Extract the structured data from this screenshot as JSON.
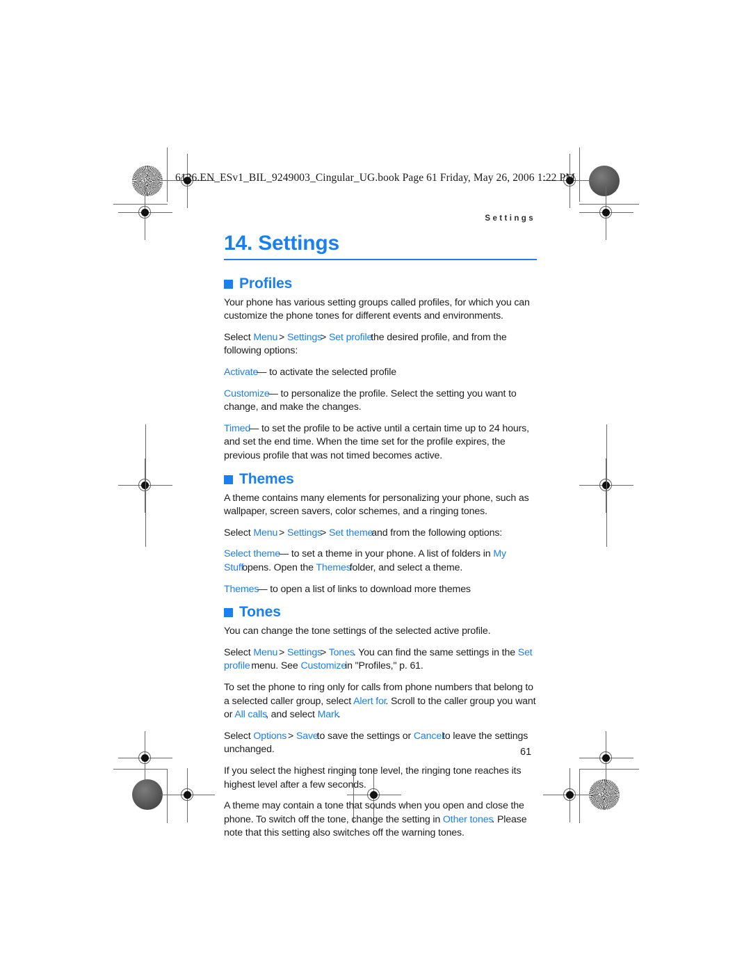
{
  "print_marks": {
    "file_header": "6126.EN_ESv1_BIL_9249003_Cingular_UG.book  Page 61  Friday, May 26, 2006  1:22 PM",
    "page_number": "61"
  },
  "running_header": "Settings",
  "colors": {
    "accent_blue": "#1a7ff0",
    "body_text": "#1d1d1d"
  },
  "chapter": {
    "title": "14. Settings"
  },
  "sections": [
    {
      "title": "Profiles",
      "paragraphs": [
        {
          "runs": [
            {
              "t": "Your phone has various setting groups called profiles, for which you can customize the phone tones for different events and environments.",
              "ui": false
            }
          ]
        },
        {
          "runs": [
            {
              "t": "Select ",
              "ui": false
            },
            {
              "t": "Menu",
              "ui": true
            },
            {
              "t": " > ",
              "ui": false
            },
            {
              "t": "Settings",
              "ui": true
            },
            {
              "t": "> ",
              "ui": false
            },
            {
              "t": "Set profile",
              "ui": true
            },
            {
              "t": "the desired profile, and from the following options:",
              "ui": false
            }
          ]
        },
        {
          "runs": [
            {
              "t": "Activate",
              "ui": true
            },
            {
              "t": "— to activate the selected profile",
              "ui": false
            }
          ]
        },
        {
          "runs": [
            {
              "t": "Customize",
              "ui": true
            },
            {
              "t": "— to personalize the profile. Select the setting you want to change, and make the changes.",
              "ui": false
            }
          ]
        },
        {
          "runs": [
            {
              "t": "Timed",
              "ui": true
            },
            {
              "t": "— to set the profile to be active until a certain time up to 24 hours, and set the end time. When the time set for the profile expires, the previous profile that was not timed becomes active.",
              "ui": false
            }
          ]
        }
      ]
    },
    {
      "title": "Themes",
      "paragraphs": [
        {
          "runs": [
            {
              "t": "A theme contains many elements for personalizing your phone, such as wallpaper, screen savers, color schemes, and a ringing tones.",
              "ui": false
            }
          ]
        },
        {
          "runs": [
            {
              "t": "Select ",
              "ui": false
            },
            {
              "t": "Menu",
              "ui": true
            },
            {
              "t": " > ",
              "ui": false
            },
            {
              "t": "Settings",
              "ui": true
            },
            {
              "t": "> ",
              "ui": false
            },
            {
              "t": "Set theme",
              "ui": true
            },
            {
              "t": "and from the following options:",
              "ui": false
            }
          ]
        },
        {
          "runs": [
            {
              "t": "Select theme",
              "ui": true
            },
            {
              "t": "— to set a theme in your phone. A list of folders in ",
              "ui": false
            },
            {
              "t": "My Stuff",
              "ui": true
            },
            {
              "t": "opens. Open the ",
              "ui": false
            },
            {
              "t": "Themes",
              "ui": true
            },
            {
              "t": "folder, and select a theme.",
              "ui": false
            }
          ]
        },
        {
          "runs": [
            {
              "t": "Themes",
              "ui": true
            },
            {
              "t": "— to open a list of links to download more themes",
              "ui": false
            }
          ]
        }
      ]
    },
    {
      "title": "Tones",
      "paragraphs": [
        {
          "runs": [
            {
              "t": "You can change the tone settings of the selected active profile.",
              "ui": false
            }
          ]
        },
        {
          "runs": [
            {
              "t": "Select ",
              "ui": false
            },
            {
              "t": "Menu",
              "ui": true
            },
            {
              "t": " > ",
              "ui": false
            },
            {
              "t": "Settings",
              "ui": true
            },
            {
              "t": "> ",
              "ui": false
            },
            {
              "t": "Tones",
              "ui": true
            },
            {
              "t": ". You can find the same settings in the ",
              "ui": false
            },
            {
              "t": "Set profile",
              "ui": true
            },
            {
              "t": " menu. See ",
              "ui": false
            },
            {
              "t": "Customize",
              "ui": true
            },
            {
              "t": "in \"Profiles,\" p. 61.",
              "ui": false
            }
          ]
        },
        {
          "runs": [
            {
              "t": "To set the phone to ring only for calls from phone numbers that belong to a selected caller group, select ",
              "ui": false
            },
            {
              "t": "Alert for",
              "ui": true
            },
            {
              "t": ". Scroll to the caller group you want or ",
              "ui": false
            },
            {
              "t": "All calls",
              "ui": true
            },
            {
              "t": ", and select ",
              "ui": false
            },
            {
              "t": "Mark",
              "ui": true
            },
            {
              "t": ".",
              "ui": false
            }
          ]
        },
        {
          "runs": [
            {
              "t": "Select ",
              "ui": false
            },
            {
              "t": "Options",
              "ui": true
            },
            {
              "t": " > ",
              "ui": false
            },
            {
              "t": "Save",
              "ui": true
            },
            {
              "t": "to save the settings or ",
              "ui": false
            },
            {
              "t": "Cancel",
              "ui": true
            },
            {
              "t": "to leave the settings unchanged.",
              "ui": false
            }
          ]
        },
        {
          "runs": [
            {
              "t": "If you select the highest ringing tone level, the ringing tone reaches its highest level after a few seconds.",
              "ui": false
            }
          ]
        },
        {
          "runs": [
            {
              "t": "A theme may contain a tone that sounds when you open and close the phone. To switch off the tone, change the setting in ",
              "ui": false
            },
            {
              "t": "Other tones",
              "ui": true
            },
            {
              "t": ". Please note that this setting also switches off the warning tones.",
              "ui": false
            }
          ]
        }
      ]
    }
  ]
}
